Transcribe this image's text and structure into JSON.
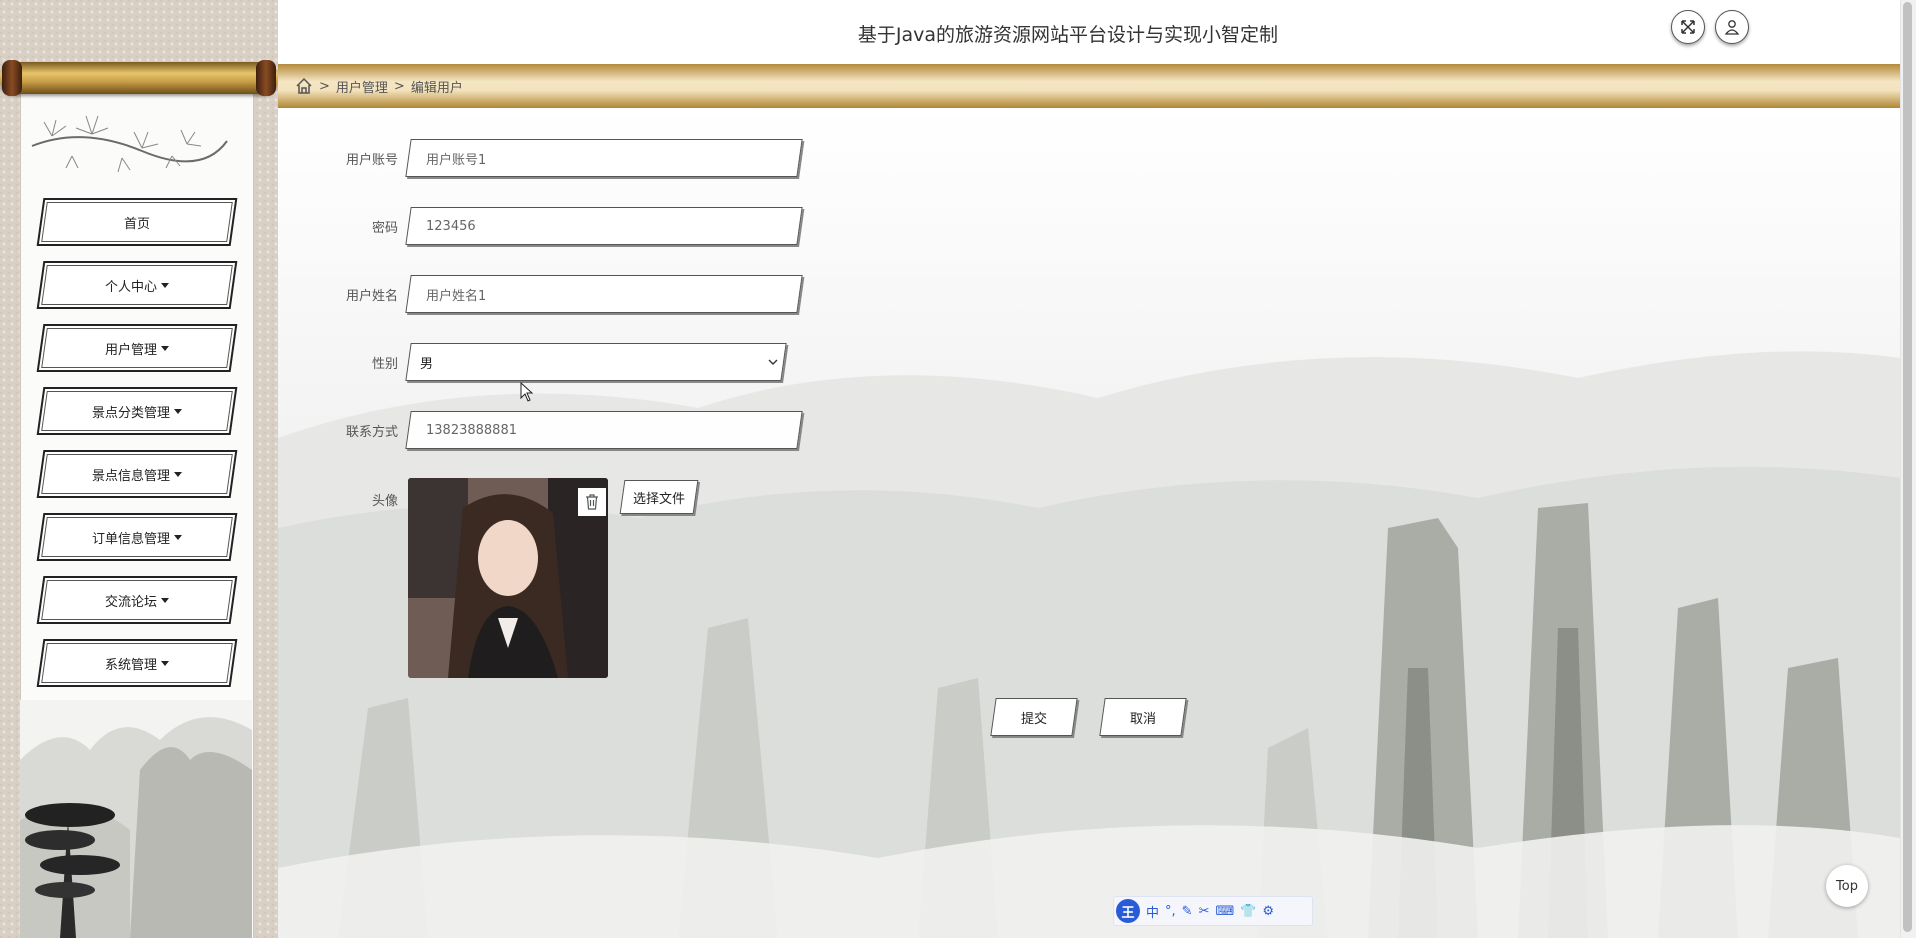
{
  "header": {
    "title": "基于Java的旅游资源网站平台设计与实现小智定制",
    "fullscreen_icon": "expand-arrows-icon",
    "user_icon": "user-icon"
  },
  "breadcrumb": {
    "home_icon": "home-icon",
    "separator": ">",
    "items": [
      "用户管理",
      "编辑用户"
    ]
  },
  "sidebar": {
    "items": [
      {
        "label": "首页",
        "has_dropdown": false
      },
      {
        "label": "个人中心",
        "has_dropdown": true
      },
      {
        "label": "用户管理",
        "has_dropdown": true
      },
      {
        "label": "景点分类管理",
        "has_dropdown": true
      },
      {
        "label": "景点信息管理",
        "has_dropdown": true
      },
      {
        "label": "订单信息管理",
        "has_dropdown": true
      },
      {
        "label": "交流论坛",
        "has_dropdown": true
      },
      {
        "label": "系统管理",
        "has_dropdown": true
      }
    ]
  },
  "form": {
    "account": {
      "label": "用户账号",
      "value": "用户账号1"
    },
    "password": {
      "label": "密码",
      "value": "123456"
    },
    "name": {
      "label": "用户姓名",
      "value": "用户姓名1"
    },
    "gender": {
      "label": "性别",
      "value": "男"
    },
    "phone": {
      "label": "联系方式",
      "value": "13823888881"
    },
    "avatar": {
      "label": "头像",
      "choose_file": "选择文件",
      "trash_icon": "trash-icon"
    },
    "submit": "提交",
    "cancel": "取消"
  },
  "floating": {
    "top_button": "Top"
  },
  "ime": {
    "logo": "王",
    "mode": "中",
    "punct": "°,"
  },
  "colors": {
    "breadcrumb_gold": "#c9a14e",
    "scroll_rod": "#d9b25a",
    "text": "#333333"
  }
}
